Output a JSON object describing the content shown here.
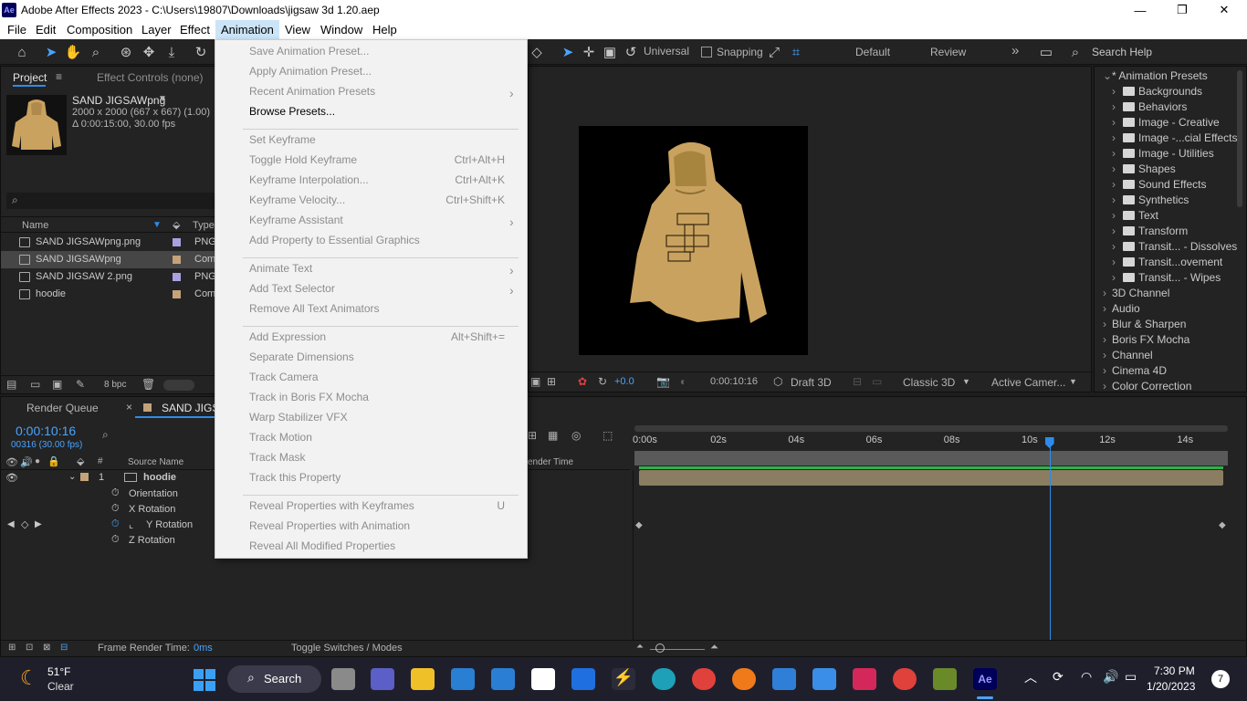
{
  "window": {
    "app_logo": "Ae",
    "title": "Adobe After Effects 2023 - C:\\Users\\19807\\Downloads\\jigsaw 3d 1.20.aep",
    "minimize": "—",
    "maximize": "❐",
    "close": "✕"
  },
  "menubar": [
    "File",
    "Edit",
    "Composition",
    "Layer",
    "Effect",
    "Animation",
    "View",
    "Window",
    "Help"
  ],
  "toolbar": {
    "universal": "Universal",
    "snapping": "Snapping",
    "workspace_default": "Default",
    "workspace_review": "Review",
    "more": "»",
    "search_help": "Search Help"
  },
  "project_panel": {
    "tab_project": "Project",
    "tab_effect_controls": "Effect Controls (none)",
    "selected_name": "SAND JIGSAWpng",
    "selected_info_1": "2000 x 2000  (667 x 667) (1.00)",
    "selected_info_2": "Δ 0:00:15:00, 30.00 fps",
    "search_placeholder": "",
    "col_name": "Name",
    "col_type": "Type",
    "items": [
      {
        "name": "SAND JIGSAWpng.png",
        "type": "PNG",
        "color": "#a8a2e0"
      },
      {
        "name": "SAND JIGSAWpng",
        "type": "Com",
        "color": "#c4a37a"
      },
      {
        "name": "SAND JIGSAW 2.png",
        "type": "PNG",
        "color": "#a8a2e0"
      },
      {
        "name": "hoodie",
        "type": "Com",
        "color": "#c4a37a"
      }
    ],
    "bpc": "8 bpc"
  },
  "viewer": {
    "exposure": "+0.0",
    "timecode": "0:00:10:16",
    "renderer": "Draft 3D",
    "renderer_mode": "Classic 3D",
    "camera": "Active Camer..."
  },
  "effects_panel": {
    "root": "* Animation Presets",
    "folders": [
      "Backgrounds",
      "Behaviors",
      "Image - Creative",
      "Image -...cial Effects",
      "Image - Utilities",
      "Shapes",
      "Sound Effects",
      "Synthetics",
      "Text",
      "Transform",
      "Transit... - Dissolves",
      "Transit...ovement",
      "Transit... - Wipes"
    ],
    "categories": [
      "3D Channel",
      "Audio",
      "Blur & Sharpen",
      "Boris FX Mocha",
      "Channel",
      "Cinema 4D",
      "Color Correction"
    ]
  },
  "animation_menu": {
    "groups": [
      [
        {
          "label": "Save Animation Preset...",
          "enabled": false
        },
        {
          "label": "Apply Animation Preset...",
          "enabled": false
        },
        {
          "label": "Recent Animation Presets",
          "enabled": false,
          "submenu": true
        },
        {
          "label": "Browse Presets...",
          "enabled": true
        }
      ],
      [
        {
          "label": "Set Keyframe",
          "enabled": false
        },
        {
          "label": "Toggle Hold Keyframe",
          "enabled": false,
          "shortcut": "Ctrl+Alt+H"
        },
        {
          "label": "Keyframe Interpolation...",
          "enabled": false,
          "shortcut": "Ctrl+Alt+K"
        },
        {
          "label": "Keyframe Velocity...",
          "enabled": false,
          "shortcut": "Ctrl+Shift+K"
        },
        {
          "label": "Keyframe Assistant",
          "enabled": false,
          "submenu": true
        },
        {
          "label": "Add Property to Essential Graphics",
          "enabled": false
        }
      ],
      [
        {
          "label": "Animate Text",
          "enabled": false,
          "submenu": true
        },
        {
          "label": "Add Text Selector",
          "enabled": false,
          "submenu": true
        },
        {
          "label": "Remove All Text Animators",
          "enabled": false
        }
      ],
      [
        {
          "label": "Add Expression",
          "enabled": false,
          "shortcut": "Alt+Shift+="
        },
        {
          "label": "Separate Dimensions",
          "enabled": false
        },
        {
          "label": "Track Camera",
          "enabled": false
        },
        {
          "label": "Track in Boris FX Mocha",
          "enabled": false
        },
        {
          "label": "Warp Stabilizer VFX",
          "enabled": false
        },
        {
          "label": "Track Motion",
          "enabled": false
        },
        {
          "label": "Track Mask",
          "enabled": false
        },
        {
          "label": "Track this Property",
          "enabled": false
        }
      ],
      [
        {
          "label": "Reveal Properties with Keyframes",
          "enabled": false,
          "shortcut": "U"
        },
        {
          "label": "Reveal Properties with Animation",
          "enabled": false
        },
        {
          "label": "Reveal All Modified Properties",
          "enabled": false
        }
      ]
    ]
  },
  "timeline": {
    "tab_render_queue": "Render Queue",
    "tab_comp": "SAND JIGSA",
    "timecode": "0:00:10:16",
    "frame_info": "00316 (30.00 fps)",
    "col_source_name": "Source Name",
    "col_render_time": "ender Time",
    "layer_index": "1",
    "layer_name": "hoodie",
    "properties": [
      "Orientation",
      "X Rotation",
      "Y Rotation",
      "Z Rotation"
    ],
    "ticks": [
      "0:00s",
      "02s",
      "04s",
      "06s",
      "08s",
      "10s",
      "12s",
      "14s"
    ],
    "playhead_seconds": 10.53,
    "frame_render_label": "Frame Render Time:",
    "frame_render_value": "0ms",
    "toggle_label": "Toggle Switches / Modes"
  },
  "taskbar": {
    "weather_temp": "51°F",
    "weather_desc": "Clear",
    "search": "Search",
    "time": "7:30 PM",
    "date": "1/20/2023",
    "notifications": "7"
  },
  "colors": {
    "accent_blue": "#2d8ceb",
    "timecode_blue": "#4aa3ff",
    "layer_bar": "#8a7d62",
    "hoodie": "#c9a25f"
  }
}
